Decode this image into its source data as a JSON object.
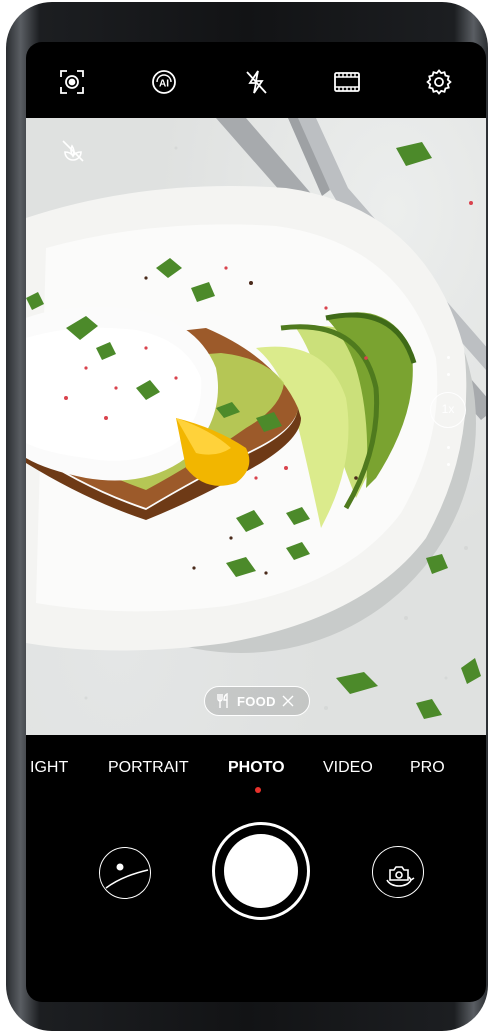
{
  "toolbar": {
    "icons": [
      "ai-stabilize-icon",
      "ai-icon",
      "flash-off-icon",
      "aspect-ratio-icon",
      "settings-icon"
    ]
  },
  "viewfinder": {
    "zoom_label": "1x",
    "scene_chip": {
      "label": "FOOD",
      "icon": "fork-knife-icon"
    }
  },
  "modes": {
    "items": [
      "IGHT",
      "PORTRAIT",
      "PHOTO",
      "VIDEO",
      "PRO"
    ],
    "selected": "PHOTO"
  },
  "colors": {
    "screen_bg": "#000000",
    "active_mode_dot": "#e8322c",
    "icon_color": "#ffffff"
  }
}
